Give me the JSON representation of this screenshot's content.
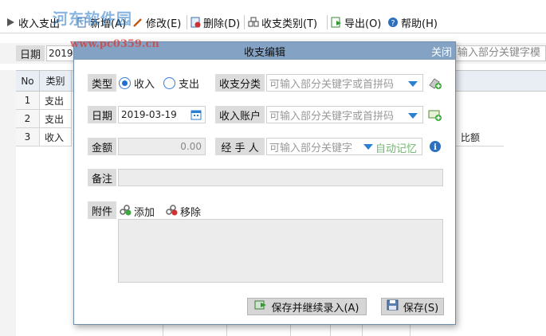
{
  "toolbar": {
    "items": [
      {
        "label": "收入支出",
        "icon": "play-icon"
      },
      {
        "label": "新增(A)",
        "icon": "new-icon"
      },
      {
        "label": "修改(E)",
        "icon": "edit-icon"
      },
      {
        "label": "删除(D)",
        "icon": "delete-icon"
      },
      {
        "label": "收支类别(T)",
        "icon": "category-icon"
      },
      {
        "label": "导出(O)",
        "icon": "export-icon"
      },
      {
        "label": "帮助(H)",
        "icon": "help-icon"
      }
    ],
    "watermark_logo": "河东软件园",
    "watermark_url": "www.pc0359.cn"
  },
  "filter": {
    "date_label": "日期",
    "date_value": "2019-03",
    "search_placeholder": "输入部分关键字模"
  },
  "grid": {
    "headers": [
      "No",
      "类别"
    ],
    "rows": [
      {
        "no": "1",
        "type": "支出"
      },
      {
        "no": "2",
        "type": "支出"
      },
      {
        "no": "3",
        "type": "收入"
      }
    ],
    "side_text": "比额"
  },
  "dialog": {
    "title": "收支编辑",
    "close_label": "关闭",
    "type_label": "类型",
    "radio_income": "收入",
    "radio_expense": "支出",
    "category_label": "收支分类",
    "category_placeholder": "可输入部分关键字或首拼码",
    "date_label": "日期",
    "date_value": "2019-03-19",
    "account_label": "收入账户",
    "account_placeholder": "可输入部分关键字或首拼码",
    "amount_label": "金额",
    "amount_value": "0.00",
    "handler_label": "经 手 人",
    "handler_placeholder": "可输入部分关键字",
    "auto_remember": "自动记忆",
    "note_label": "备注",
    "attach_label": "附件",
    "attach_add": "添加",
    "attach_remove": "移除",
    "save_continue": "保存并继续录入(A)",
    "save": "保存(S)"
  },
  "colors": {
    "title_bar": "#84a2c4",
    "accent": "#2a7fd0",
    "label_bg": "#dcdcdc"
  }
}
